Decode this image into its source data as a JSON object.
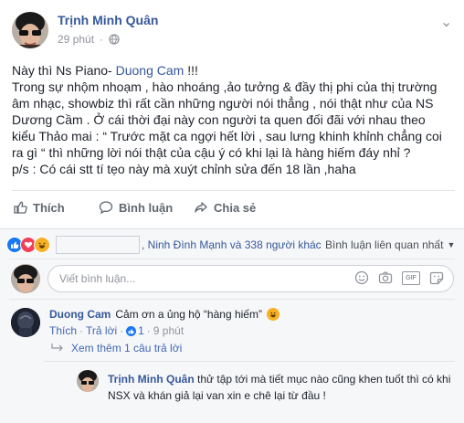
{
  "post": {
    "author": "Trịnh Minh Quân",
    "time": "29 phút",
    "lines": [
      {
        "pre": "Này thì Ns Piano- ",
        "link": "Duong Cam",
        "post": " !!!"
      },
      {
        "pre": "Trong sự nhộm nhoạm , hào nhoáng ,ảo tưởng & đầy thị phi của thị trường",
        "link": "",
        "post": ""
      },
      {
        "pre": "âm nhạc, showbiz thì rất cần những người nói thẳng , nói thật như của NS",
        "link": "",
        "post": ""
      },
      {
        "pre": "Dương Cầm . Ở cái thời đại này con người ta quen đối đãi với nhau theo",
        "link": "",
        "post": ""
      },
      {
        "pre": "kiểu Thảo mai : “ Trước mặt ca ngợi hết lời , sau lưng khinh khỉnh chẳng coi",
        "link": "",
        "post": ""
      },
      {
        "pre": "ra gì “ thì những lời nói thật của cậu ý có khi lại là hàng hiếm đáy nhỉ ?",
        "link": "",
        "post": ""
      },
      {
        "pre": "p/s : Có cái stt tí tẹo này mà xuýt chỉnh sửa đến 18 lần ,haha",
        "link": "",
        "post": ""
      }
    ]
  },
  "actions": {
    "like": "Thích",
    "comment": "Bình luận",
    "share": "Chia sẻ"
  },
  "reactions": {
    "text": ", Ninh Đình Mạnh và 338 người khác",
    "sort_label": "Bình luận liên quan nhất"
  },
  "composer": {
    "placeholder": "Viết bình luận..."
  },
  "comments": [
    {
      "author": "Duong Cam",
      "text": "Cảm ơn a ủng hộ “hàng hiếm”",
      "like": "Thích",
      "reply": "Trả lời",
      "reactions_count": "1",
      "time": "9 phút"
    }
  ],
  "more_replies": "Xem thêm 1 câu trả lời",
  "reply": {
    "author": "Trịnh Minh Quân",
    "line1": "thử tập tới mà tiết mục nào cũng khen tuốt thì có khi",
    "line2": "NSX và khán giả lại van xin e chê lại từ đầu !"
  },
  "colors": {
    "link": "#365899",
    "action_blue": "#4267b2",
    "like_blue": "#1877f2",
    "love_red": "#f33e58",
    "haha_yellow": "#f7b125"
  }
}
